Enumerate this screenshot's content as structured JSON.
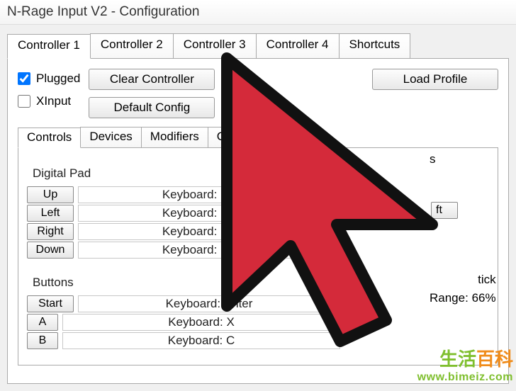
{
  "window": {
    "title": "N-Rage Input V2 - Configuration"
  },
  "tabs": {
    "items": [
      "Controller 1",
      "Controller 2",
      "Controller 3",
      "Controller 4",
      "Shortcuts"
    ],
    "active": 0
  },
  "plugged": {
    "label": "Plugged",
    "checked": true
  },
  "xinput": {
    "label": "XInput",
    "checked": false
  },
  "buttons": {
    "clear": "Clear Controller",
    "default": "Default Config",
    "load": "Load Profile"
  },
  "subtabs": {
    "items": [
      "Controls",
      "Devices",
      "Modifiers",
      "Controller Pak"
    ],
    "active": 0
  },
  "digital_pad": {
    "title": "Digital Pad",
    "rows": [
      {
        "label": "Up",
        "value": "Keyboard: Num 8"
      },
      {
        "label": "Left",
        "value": "Keyboard: Num 4"
      },
      {
        "label": "Right",
        "value": "Keyboard: Num 6"
      },
      {
        "label": "Down",
        "value": "Keyboard: Num 2"
      }
    ]
  },
  "buttons_group": {
    "title": "Buttons",
    "rows": [
      {
        "label": "Start",
        "value": "Keyboard: Enter"
      },
      {
        "label": "A",
        "value": "Keyboard: X"
      },
      {
        "label": "B",
        "value": "Keyboard: C"
      }
    ]
  },
  "right_side": {
    "partial_title_top": "s",
    "row_label": "ft",
    "analog_title": "Analog Stick",
    "partial_title_bottom": "tick",
    "range_label": "Range:",
    "range_value": "66%"
  },
  "watermark": {
    "cn": "生活百科",
    "url": "www.bimeiz.com"
  }
}
